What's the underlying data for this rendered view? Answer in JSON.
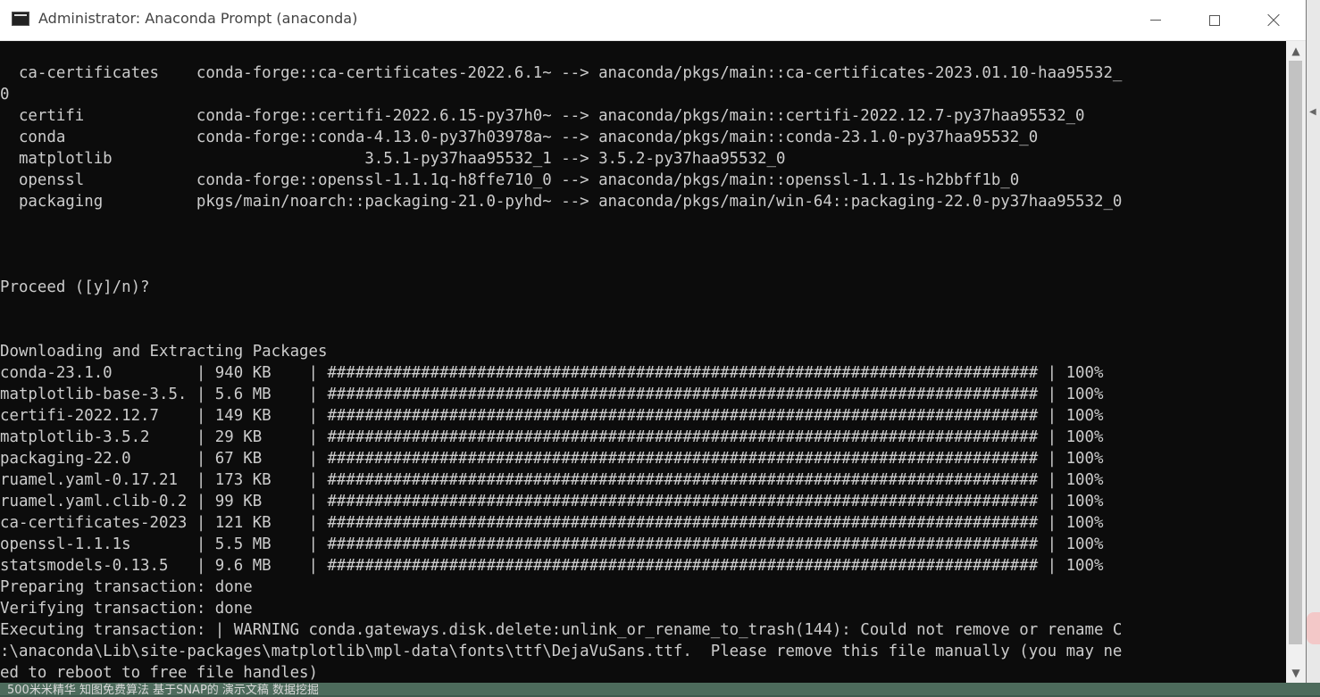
{
  "window": {
    "title": "Administrator: Anaconda Prompt (anaconda)",
    "controls": {
      "minimize": "—",
      "maximize": "☐",
      "close": "✕"
    }
  },
  "console_lines": [
    "",
    "  ca-certificates    conda-forge::ca-certificates-2022.6.1~ --> anaconda/pkgs/main::ca-certificates-2023.01.10-haa95532_",
    "0",
    "  certifi            conda-forge::certifi-2022.6.15-py37h0~ --> anaconda/pkgs/main::certifi-2022.12.7-py37haa95532_0",
    "  conda              conda-forge::conda-4.13.0-py37h03978a~ --> anaconda/pkgs/main::conda-23.1.0-py37haa95532_0",
    "  matplotlib                           3.5.1-py37haa95532_1 --> 3.5.2-py37haa95532_0",
    "  openssl            conda-forge::openssl-1.1.1q-h8ffe710_0 --> anaconda/pkgs/main::openssl-1.1.1s-h2bbff1b_0",
    "  packaging          pkgs/main/noarch::packaging-21.0-pyhd~ --> anaconda/pkgs/main/win-64::packaging-22.0-py37haa95532_0",
    "",
    "",
    "",
    "Proceed ([y]/n)?",
    "",
    "",
    "Downloading and Extracting Packages",
    "conda-23.1.0         | 940 KB    | ############################################################################ | 100%",
    "matplotlib-base-3.5. | 5.6 MB    | ############################################################################ | 100%",
    "certifi-2022.12.7    | 149 KB    | ############################################################################ | 100%",
    "matplotlib-3.5.2     | 29 KB     | ############################################################################ | 100%",
    "packaging-22.0       | 67 KB     | ############################################################################ | 100%",
    "ruamel.yaml-0.17.21  | 173 KB    | ############################################################################ | 100%",
    "ruamel.yaml.clib-0.2 | 99 KB     | ############################################################################ | 100%",
    "ca-certificates-2023 | 121 KB    | ############################################################################ | 100%",
    "openssl-1.1.1s       | 5.5 MB    | ############################################################################ | 100%",
    "statsmodels-0.13.5   | 9.6 MB    | ############################################################################ | 100%",
    "Preparing transaction: done",
    "Verifying transaction: done",
    "Executing transaction: | WARNING conda.gateways.disk.delete:unlink_or_rename_to_trash(144): Could not remove or rename C",
    ":\\anaconda\\Lib\\site-packages\\matplotlib\\mpl-data\\fonts\\ttf\\DejaVuSans.ttf.  Please remove this file manually (you may ne",
    "ed to reboot to free file handles)"
  ],
  "scrollbar": {
    "up_arrow": "▲",
    "down_arrow": "▼"
  },
  "desktop": {
    "taskbar_text": "500米米精华 知图免费算法 基于SNAP的     演示文稿      数据挖掘"
  },
  "side_strip": {
    "icon": "◀"
  },
  "colors": {
    "console_bg": "#0c0c0c",
    "console_fg": "#cccccc",
    "titlebar_bg": "#ffffff"
  }
}
